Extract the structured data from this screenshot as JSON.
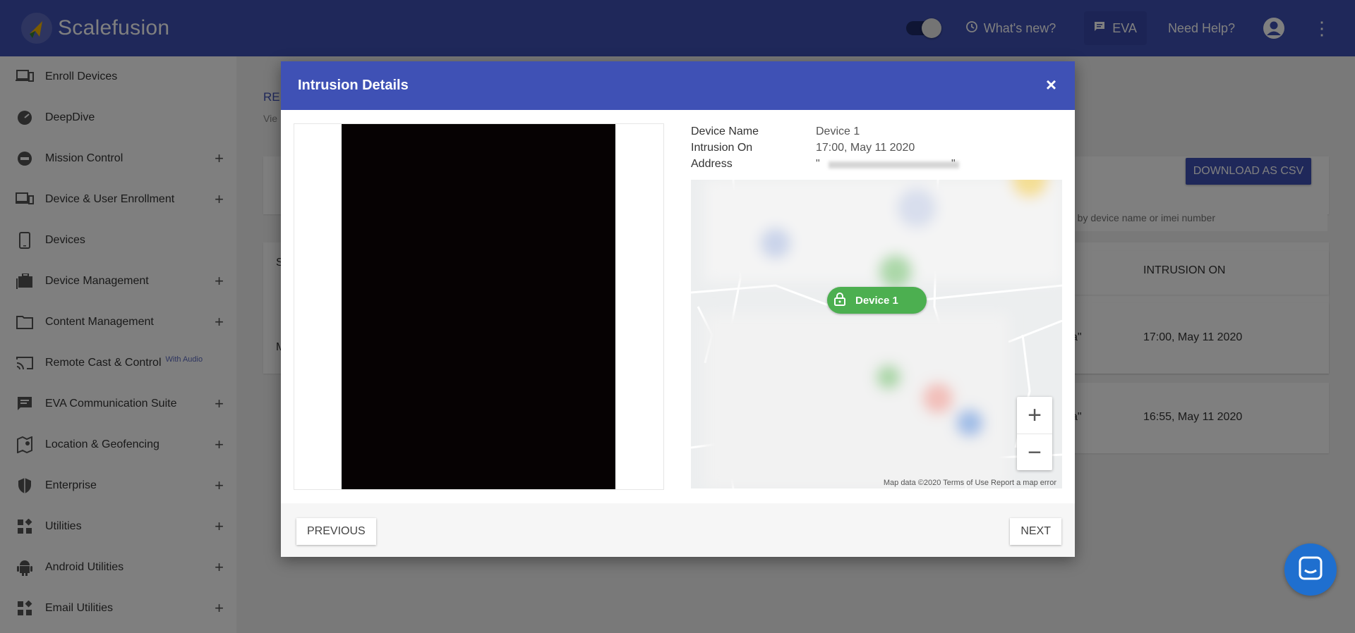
{
  "header": {
    "brand": "Scalefusion",
    "whats_new": "What's new?",
    "eva": "EVA",
    "need_help": "Need Help?",
    "accent": "#3f51b5"
  },
  "sidebar": {
    "items": [
      {
        "label": "Enroll Devices",
        "icon": "enroll-icon",
        "expandable": false
      },
      {
        "label": "DeepDive",
        "icon": "dashboard-icon",
        "expandable": false
      },
      {
        "label": "Mission Control",
        "icon": "mission-icon",
        "expandable": true
      },
      {
        "label": "Device & User Enrollment",
        "icon": "devices-icon",
        "expandable": true
      },
      {
        "label": "Devices",
        "icon": "phone-icon",
        "expandable": false
      },
      {
        "label": "Device Management",
        "icon": "management-icon",
        "expandable": true
      },
      {
        "label": "Content Management",
        "icon": "folder-icon",
        "expandable": true
      },
      {
        "label": "Remote Cast & Control",
        "badge": "With Audio",
        "icon": "cast-icon",
        "expandable": false
      },
      {
        "label": "EVA Communication Suite",
        "icon": "chat-icon",
        "expandable": true
      },
      {
        "label": "Location & Geofencing",
        "icon": "location-icon",
        "expandable": true
      },
      {
        "label": "Enterprise",
        "icon": "shield-icon",
        "expandable": true
      },
      {
        "label": "Utilities",
        "icon": "widgets-icon",
        "expandable": true
      },
      {
        "label": "Android Utilities",
        "icon": "android-icon",
        "expandable": true
      },
      {
        "label": "Email Utilities",
        "icon": "widgets-icon",
        "expandable": true
      }
    ]
  },
  "main": {
    "title_partial": "REP",
    "subtitle_partial": "Vie",
    "card_letter_s": "S",
    "card_letter_m": "M",
    "download_csv": "DOWNLOAD AS CSV",
    "search_placeholder": "h by device name or imei number",
    "column_intrusion_on": "INTRUSION ON",
    "rows": [
      {
        "quote": "a\"",
        "date": "17:00, May 11 2020"
      },
      {
        "quote": "a\"",
        "date": "16:55, May 11 2020"
      }
    ]
  },
  "modal": {
    "title": "Intrusion Details",
    "close": "×",
    "device_name_label": "Device Name",
    "device_name": "Device 1",
    "intrusion_on_label": "Intrusion On",
    "intrusion_on": "17:00, May 11 2020",
    "address_label": "Address",
    "address_open": "\"",
    "address_close": "\"",
    "map": {
      "pin_label": "Device 1",
      "zoom_in": "+",
      "zoom_out": "−",
      "credit": "Map data ©2020  Terms of Use   Report a map error"
    },
    "previous": "PREVIOUS",
    "next": "NEXT"
  }
}
